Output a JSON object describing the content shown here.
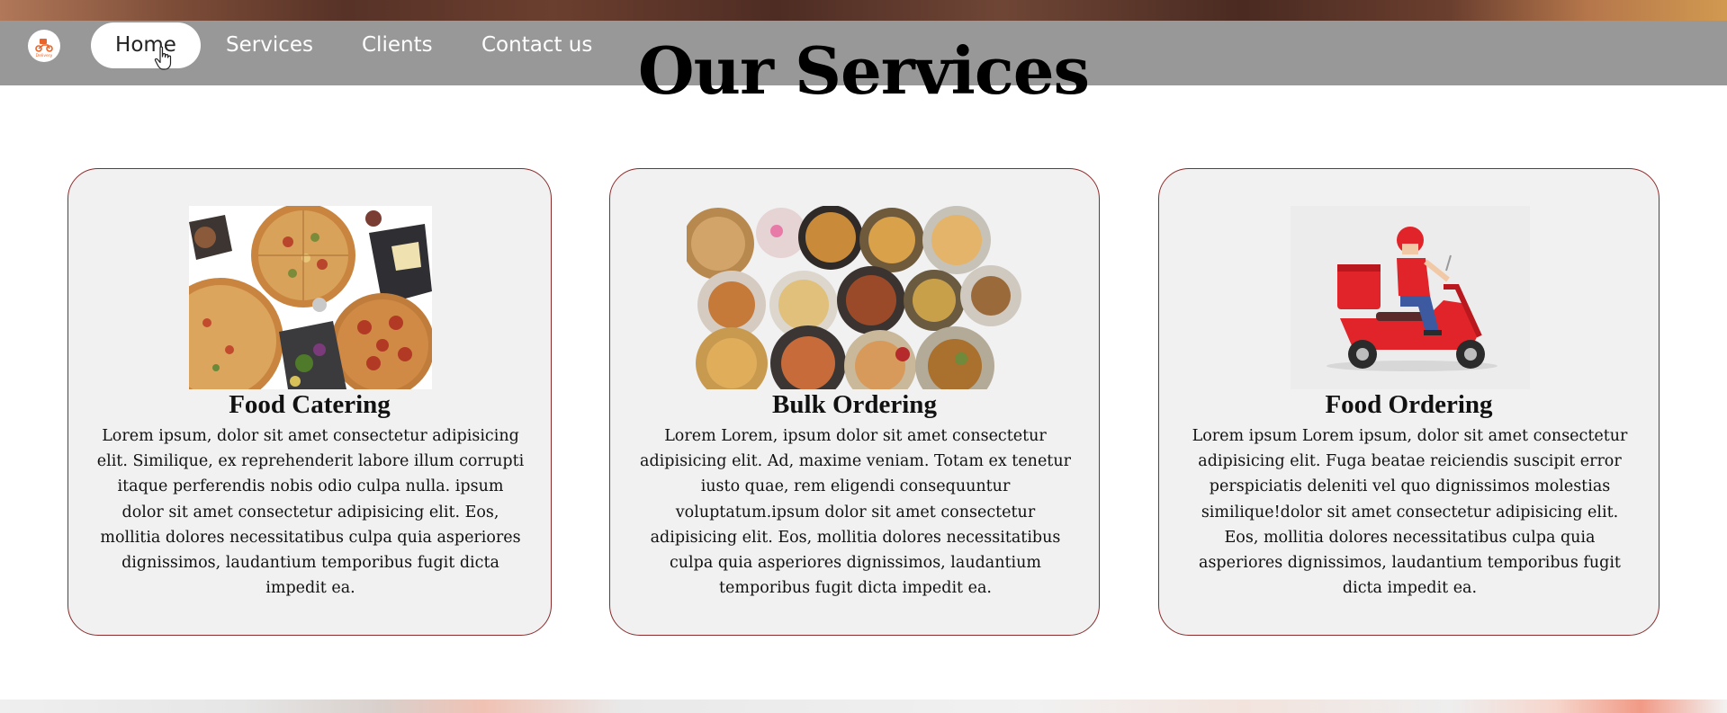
{
  "nav": {
    "logo_text": "Delivery",
    "items": [
      {
        "label": "Home",
        "active": true
      },
      {
        "label": "Services",
        "active": false
      },
      {
        "label": "Clients",
        "active": false
      },
      {
        "label": "Contact us",
        "active": false
      }
    ]
  },
  "section": {
    "title": "Our Services"
  },
  "cards": [
    {
      "title": "Food Catering",
      "image_icon": "pizza-platter-image",
      "text": "Lorem ipsum, dolor sit amet consectetur adipisicing elit. Similique, ex reprehenderit labore illum corrupti itaque perferendis nobis odio culpa nulla. ipsum dolor sit amet consectetur adipisicing elit. Eos, mollitia dolores necessitatibus culpa quia asperiores dignissimos, laudantium temporibus fugit dicta impedit ea."
    },
    {
      "title": "Bulk Ordering",
      "image_icon": "thali-plates-image",
      "text": "Lorem Lorem, ipsum dolor sit amet consectetur adipisicing elit. Ad, maxime veniam. Totam ex tenetur iusto quae, rem eligendi consequuntur voluptatum.ipsum dolor sit amet consectetur adipisicing elit. Eos, mollitia dolores necessitatibus culpa quia asperiores dignissimos, laudantium temporibus fugit dicta impedit ea."
    },
    {
      "title": "Food Ordering",
      "image_icon": "delivery-scooter-image",
      "text": "Lorem ipsum Lorem ipsum, dolor sit amet consectetur adipisicing elit. Fuga beatae reiciendis suscipit error perspiciatis deleniti vel quo dignissimos molestias similique!dolor sit amet consectetur adipisicing elit. Eos, mollitia dolores necessitatibus culpa quia asperiores dignissimos, laudantium temporibus fugit dicta impedit ea."
    }
  ],
  "colors": {
    "navbar_bg": "#989898",
    "card_border": "#8a2a2a",
    "card_bg": "#f1f1f1",
    "brand_orange": "#e8642a",
    "scooter_red": "#e0242a"
  }
}
